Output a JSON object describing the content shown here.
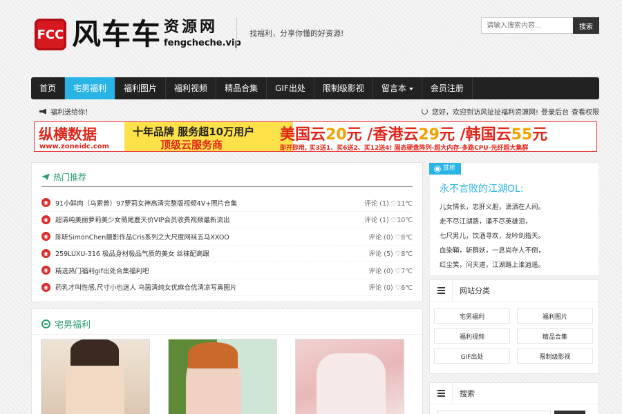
{
  "header": {
    "logo_badge": "FCC",
    "logo_cn": "风车车",
    "logo_sub": "资源网",
    "logo_url": "fengcheche.vip",
    "slogan": "找福利，分享你懂的好资源!",
    "search_placeholder": "请输入搜索内容...",
    "search_button": "搜索"
  },
  "nav": {
    "items": [
      {
        "label": "首页"
      },
      {
        "label": "宅男福利"
      },
      {
        "label": "福利图片"
      },
      {
        "label": "福利视频"
      },
      {
        "label": "精品合集"
      },
      {
        "label": "GIF出处"
      },
      {
        "label": "限制级影视"
      },
      {
        "label": "留言本"
      },
      {
        "label": "会员注册"
      }
    ],
    "active_index": 1
  },
  "notice": {
    "left": "福利送给你！",
    "welcome": "您好，欢迎到访风扯扯福利资源网!",
    "login": "登录后台",
    "perm": "查看权限"
  },
  "banner": {
    "brand": "纵横数据",
    "url": "www.zoneidc.com",
    "line1": "十年品牌 服务超10万用户",
    "line2": "顶级云服务商",
    "right_a": "美国云",
    "right_a_num": "20",
    "right_b": "元 /香港云",
    "right_b_num": "29",
    "right_c": "元 /韩国云",
    "right_c_num": "55",
    "right_d": "元",
    "right_small": "即开即用, 买3送1、买6送2、买12送4! 固态硬盘阵列-超大内存-多路CPU-光纤超大集群"
  },
  "hot": {
    "title": "热门推荐",
    "items": [
      {
        "title": "91小鲜肉（乌索普）97萝莉女神高清完整版视频4V+照片合集",
        "meta": "评论 (1) ♡11℃"
      },
      {
        "title": "超清纯美丽萝莉美少女萌尾鹿天价VIP会员收费视频最新流出",
        "meta": "评论 (1) ♡10℃"
      },
      {
        "title": "陈昕SimonChen摄影作品Cris系列之大尺度网袜五马XXOO",
        "meta": "评论 (0) ♡8℃"
      },
      {
        "title": "259LUXU-316 极品身材极品气质的美女 丝袜配高跟",
        "meta": "评论 (5) ♡8℃"
      },
      {
        "title": "精选热门福利gif出处合集福利吧",
        "meta": "评论 (0) ♡7℃"
      },
      {
        "title": "药乳才叫性感,尺寸小也迷人 乌茵清纯女优麻仓优清凉写真图片",
        "meta": "评论 (0) ♡6℃"
      }
    ]
  },
  "category": {
    "title": "宅男福利"
  },
  "sidebar": {
    "tag": "赏析",
    "ad_title": "永不言败的江湖OL:",
    "ad_lines": [
      "儿女情长，忠肝义胆，潇洒在人间。",
      "走不尽江湖路，涌不尽英雄泪，",
      "七尺男儿，饮酒寻欢，龙吟剑指天。",
      "血染鞘，斩群妖，一息尚存人不倒，",
      "红尘笑，问天道，江湖路上谁逍遥。"
    ],
    "cat_title": "网站分类",
    "cats": [
      "宅男福利",
      "福利图片",
      "福利视频",
      "精品合集",
      "GIF出处",
      "限制级影视"
    ],
    "search_title": "搜索"
  },
  "colors": {
    "accent": "#2ab4e6",
    "green": "#2a9d6e",
    "nav_bg": "#222222",
    "logo_red": "#d6181f"
  }
}
